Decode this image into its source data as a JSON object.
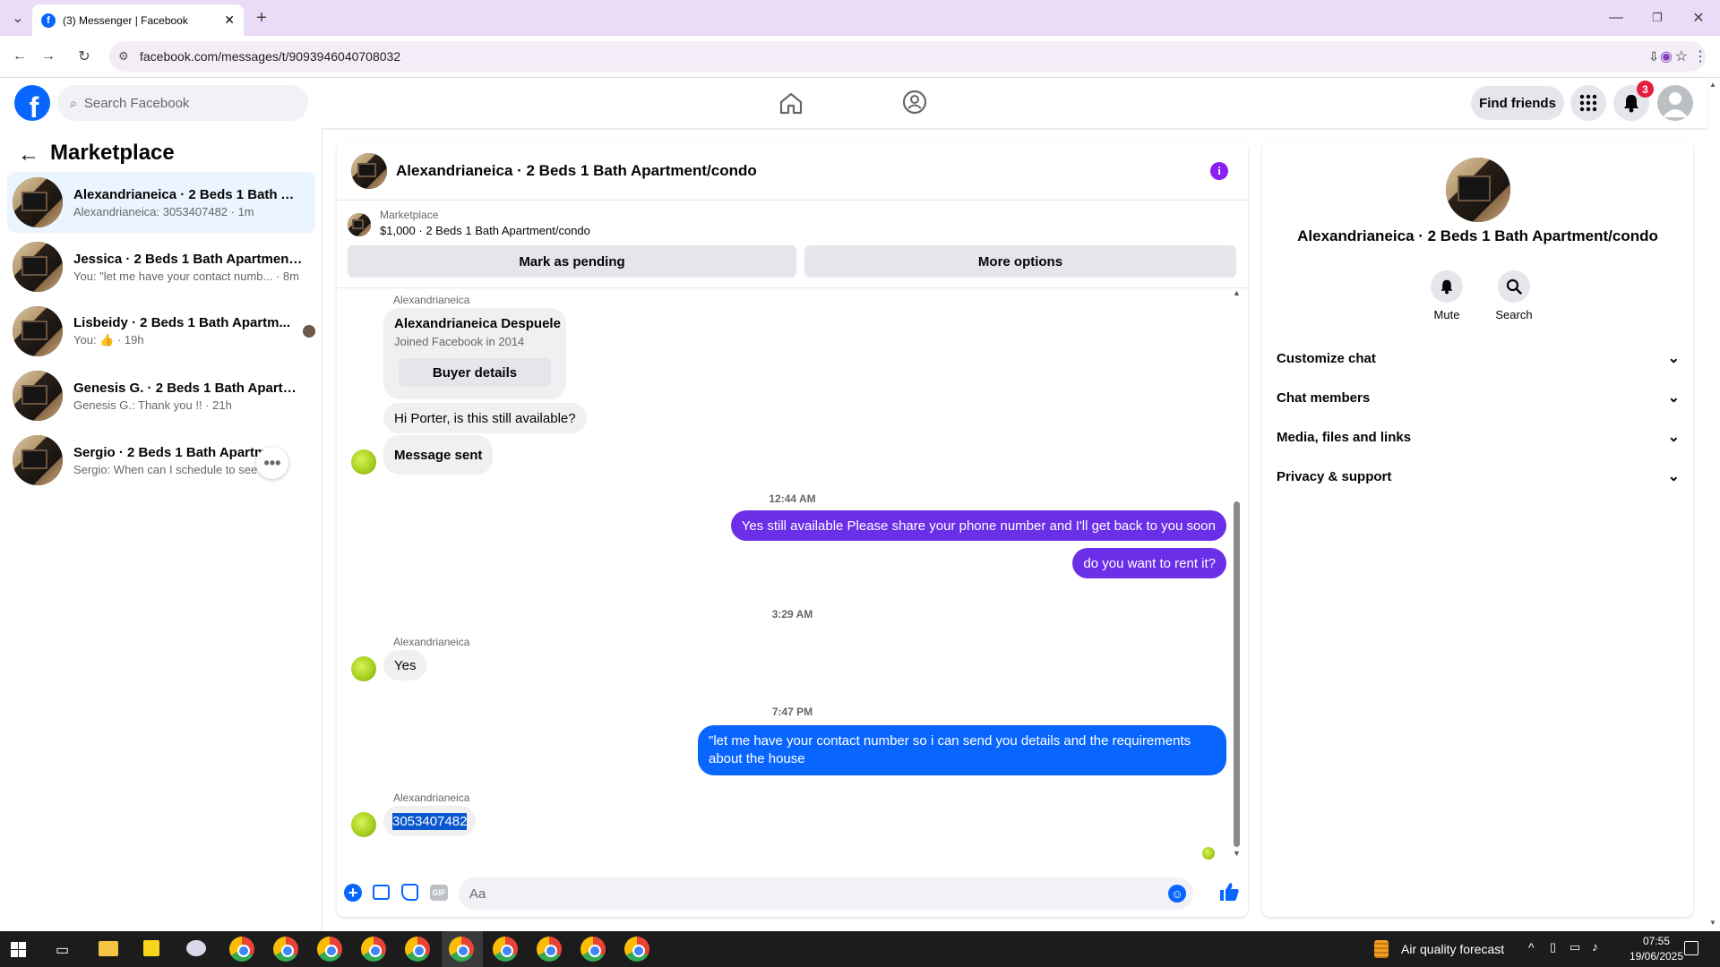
{
  "browser": {
    "tab_title": "(3) Messenger | Facebook",
    "url": "facebook.com/messages/t/9093946040708032"
  },
  "fb_header": {
    "search_placeholder": "Search Facebook",
    "find_friends": "Find friends",
    "notifications_count": "3"
  },
  "left_panel": {
    "title": "Marketplace",
    "conversations": [
      {
        "title": "Alexandrianeica · 2 Beds 1 Bath Ap...",
        "subtitle": "Alexandrianeica: 3053407482 · 1m"
      },
      {
        "title": "Jessica · 2 Beds 1 Bath Apartment/...",
        "subtitle": "You: \"let me have your contact numb... · 8m"
      },
      {
        "title": "Lisbeidy · 2 Beds 1 Bath Apartm...",
        "subtitle": "You: 👍 · 19h"
      },
      {
        "title": "Genesis G. · 2 Beds 1 Bath Apartm...",
        "subtitle": "Genesis G.: Thank you !! · 21h"
      },
      {
        "title": "Sergio · 2 Beds 1 Bath Apartme...",
        "subtitle": "Sergio: When can I schedule to see t... d"
      }
    ]
  },
  "chat": {
    "title": "Alexandrianeica · 2 Beds 1 Bath Apartment/condo",
    "listing": {
      "label": "Marketplace",
      "detail": "$1,000 · 2 Beds 1 Bath Apartment/condo",
      "mark_pending": "Mark as pending",
      "more_options": "More options"
    },
    "messages": {
      "sender1": "Alexandrianeica",
      "card_name": "Alexandrianeica Despuele",
      "card_joined": "Joined Facebook in 2014",
      "card_button": "Buyer details",
      "m1": "Hi Porter, is this still available?",
      "m2": "Message sent",
      "time1": "12:44 AM",
      "m3": "Yes still available Please share your phone number and I'll get back to you soon",
      "m4": "do you want to rent it?",
      "time2": "3:29 AM",
      "sender2": "Alexandrianeica",
      "m5": "Yes",
      "time3": "7:47 PM",
      "m6": "\"let me have your contact number so i can send you details and the requirements about the house",
      "sender3": "Alexandrianeica",
      "m7": "3053407482"
    },
    "composer_placeholder": "Aa"
  },
  "right_panel": {
    "title": "Alexandrianeica · 2 Beds 1 Bath Apartment/condo",
    "mute": "Mute",
    "search": "Search",
    "sections": [
      "Customize chat",
      "Chat members",
      "Media, files and links",
      "Privacy & support"
    ]
  },
  "taskbar": {
    "weather": "Air quality forecast",
    "time": "07:55",
    "date": "19/06/2025"
  },
  "colors": {
    "fb_blue": "#0866ff",
    "outgoing_purple": "#6b2fe8",
    "tab_bar": "#eadcf6"
  }
}
